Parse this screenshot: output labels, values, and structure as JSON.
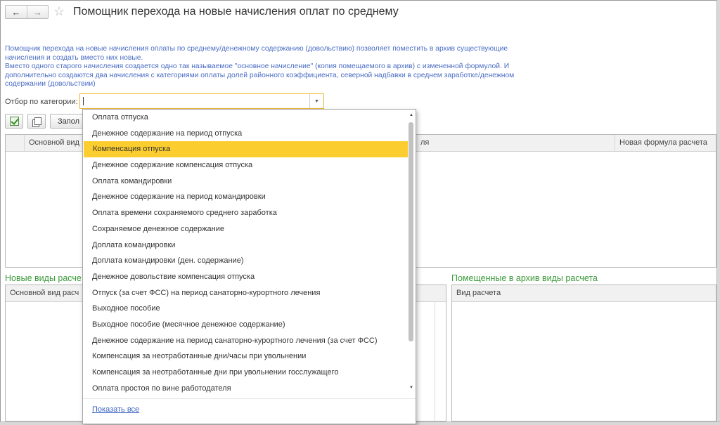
{
  "header": {
    "title": "Помощник перехода на новые начисления оплат по среднему",
    "back_icon": "arrow-left-icon",
    "forward_icon": "arrow-right-icon",
    "favorite_icon": "star-icon"
  },
  "description": {
    "line1": "Помощник перехода на новые начисления оплаты по среднему/денежному содержанию (довольствию) позволяет поместить в архив существующие",
    "line2": "начисления и создать вместо них новые.",
    "line3": "Вместо одного старого начисления создается одно так называемое \"основное начисление\" (копия помещаемого в архив) с измененной формулой. И",
    "line4": "дополнительно создаются два начисления с категориями оплаты долей районного коэффициента, северной надбавки в среднем заработке/денежном",
    "line5": "содержании (довольствии)"
  },
  "filter": {
    "label": "Отбор по категории:",
    "value": ""
  },
  "toolbar": {
    "check_icon": "check-all-icon",
    "copy_icon": "copy-icon",
    "fill_label": "Запол"
  },
  "top_table": {
    "columns": [
      "Основной вид",
      "ля",
      "Новая формула расчета"
    ]
  },
  "new_section": {
    "title": "Новые виды расче",
    "columns": [
      "Основной вид расч"
    ]
  },
  "archive_section": {
    "title": "Помещенные в архив виды расчета",
    "columns": [
      "Вид расчета"
    ]
  },
  "dropdown": {
    "items": [
      "Оплата отпуска",
      "Денежное содержание на период отпуска",
      "Компенсация отпуска",
      "Денежное содержание компенсация отпуска",
      "Оплата командировки",
      "Денежное содержание на период командировки",
      "Оплата времени сохраняемого среднего заработка",
      "Сохраняемое денежное содержание",
      "Доплата командировки",
      "Доплата командировки (ден. содержание)",
      "Денежное довольствие компенсация отпуска",
      "Отпуск (за счет ФСС) на период санаторно-курортного лечения",
      "Выходное пособие",
      "Выходное пособие (месячное денежное содержание)",
      "Денежное содержание на период санаторно-курортного лечения (за счет ФСС)",
      "Компенсация за неотработанные дни/часы при увольнении",
      "Компенсация за неотработанные дни при увольнении госслужащего",
      "Оплата простоя по вине работодателя"
    ],
    "selected_index": 2,
    "show_all": "Показать все"
  },
  "colors": {
    "accent_selection": "#fbcd2e",
    "description_text": "#4a6cc4",
    "section_title": "#3a9a3a",
    "link": "#3b62c4",
    "input_focus_border": "#e9b731"
  }
}
